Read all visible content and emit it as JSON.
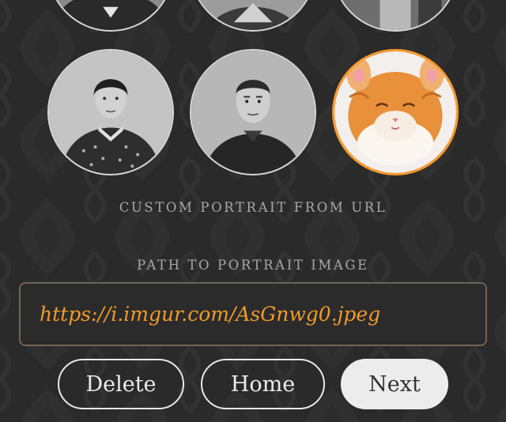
{
  "portraits": [
    {
      "name": "portrait-top-left",
      "selected": false
    },
    {
      "name": "portrait-top-center",
      "selected": false
    },
    {
      "name": "portrait-top-right",
      "selected": false
    },
    {
      "name": "portrait-woman",
      "selected": false
    },
    {
      "name": "portrait-man",
      "selected": false
    },
    {
      "name": "portrait-kitten",
      "selected": true
    }
  ],
  "custom_portrait_heading": "CUSTOM PORTRAIT FROM URL",
  "path_label": "PATH TO PORTRAIT IMAGE",
  "url_field": {
    "value": "https://i.imgur.com/AsGnwg0.jpeg"
  },
  "buttons": {
    "delete": "Delete",
    "home": "Home",
    "next": "Next"
  },
  "colors": {
    "accent": "#ff9a2a",
    "background": "#2a2a2a",
    "field_border": "#6f6553"
  }
}
